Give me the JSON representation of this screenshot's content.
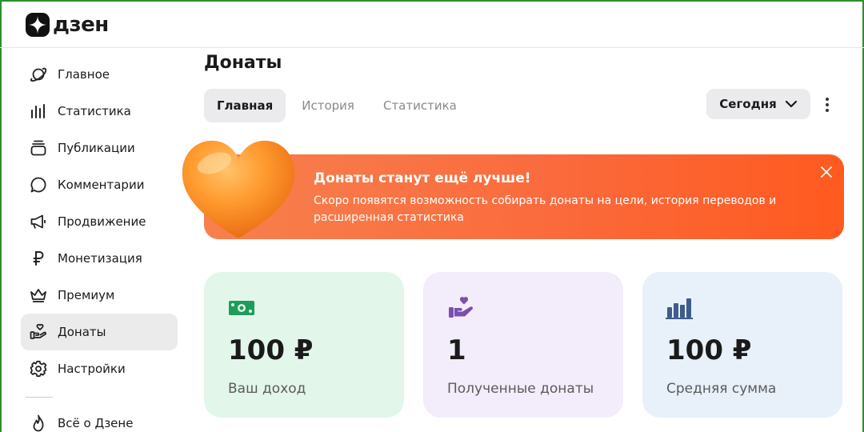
{
  "brand": {
    "name": "дзен"
  },
  "sidebar": {
    "items": [
      {
        "label": "Главное",
        "icon": "planet-icon"
      },
      {
        "label": "Статистика",
        "icon": "bar-chart-icon"
      },
      {
        "label": "Публикации",
        "icon": "publications-icon"
      },
      {
        "label": "Комментарии",
        "icon": "comment-icon"
      },
      {
        "label": "Продвижение",
        "icon": "megaphone-icon"
      },
      {
        "label": "Монетизация",
        "icon": "ruble-icon"
      },
      {
        "label": "Премиум",
        "icon": "crown-icon"
      },
      {
        "label": "Донаты",
        "icon": "donate-hand-icon",
        "active": true
      },
      {
        "label": "Настройки",
        "icon": "gear-icon"
      }
    ],
    "footer_item": {
      "label": "Всё о Дзене",
      "icon": "flame-icon"
    }
  },
  "main": {
    "title": "Донаты",
    "tabs": [
      {
        "label": "Главная",
        "active": true
      },
      {
        "label": "История",
        "active": false
      },
      {
        "label": "Статистика",
        "active": false
      }
    ],
    "period_select": {
      "value": "Сегодня"
    }
  },
  "banner": {
    "title": "Донаты станут ещё лучше!",
    "text": "Скоро появятся возможность собирать донаты на цели, история переводов и расширенная статистика",
    "color": "#fa6a3c"
  },
  "cards": [
    {
      "value": "100 ₽",
      "label": "Ваш доход",
      "bg": "#e2f6ea",
      "icon": "money-icon",
      "icon_color": "#1f9c5a"
    },
    {
      "value": "1",
      "label": "Полученные донаты",
      "bg": "#f3ecfa",
      "icon": "donate-hand-icon",
      "icon_color": "#7a4fb0"
    },
    {
      "value": "100 ₽",
      "label": "Средняя сумма",
      "bg": "#e8f0fa",
      "icon": "bar-chart-icon",
      "icon_color": "#3f5c8a"
    }
  ]
}
